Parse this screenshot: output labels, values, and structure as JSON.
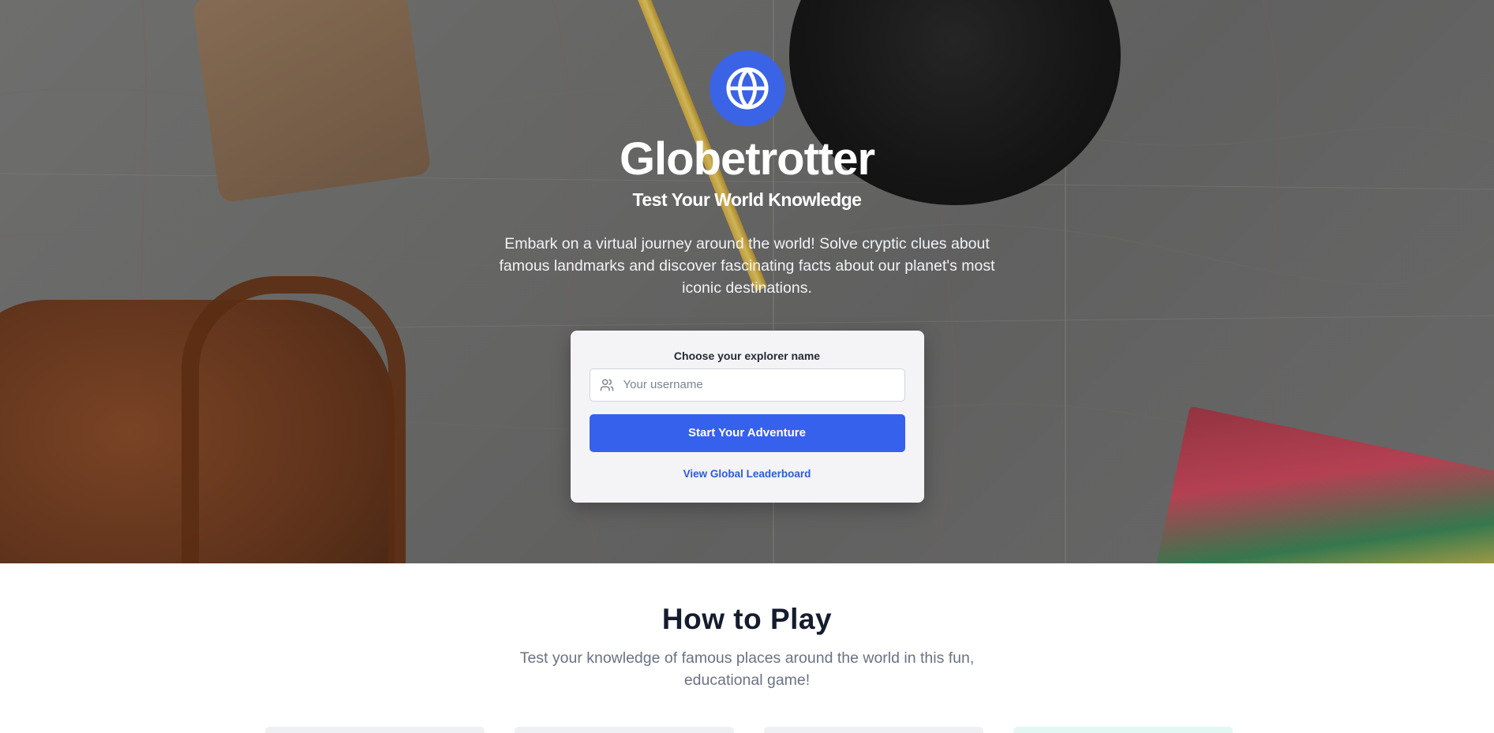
{
  "hero": {
    "logo_icon": "globe-icon",
    "title": "Globetrotter",
    "subtitle": "Test Your World Knowledge",
    "description": "Embark on a virtual journey around the world! Solve cryptic clues about famous landmarks and discover fascinating facts about our planet's most iconic destinations."
  },
  "login": {
    "label": "Choose your explorer name",
    "input_icon": "users-icon",
    "username_placeholder": "Your username",
    "username_value": "",
    "start_button": "Start Your Adventure",
    "leaderboard_link": "View Global Leaderboard"
  },
  "how_to_play": {
    "title": "How to Play",
    "subtitle": "Test your knowledge of famous places around the world in this fun, educational game!"
  },
  "colors": {
    "accent": "#3661ec",
    "logo_bg": "#3b63e6",
    "link": "#2f5ad8",
    "heading_dark": "#141c2e"
  }
}
